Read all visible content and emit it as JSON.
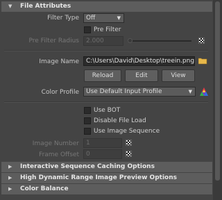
{
  "file_attributes": {
    "title": "File Attributes",
    "filter_type_label": "Filter Type",
    "filter_type_value": "Off",
    "pre_filter_label": "Pre Filter",
    "pre_filter_checked": false,
    "pre_filter_radius_label": "Pre Filter Radius",
    "pre_filter_radius_value": "2.000",
    "image_name_label": "Image Name",
    "image_name_value": "C:\\Users\\David\\Desktop\\treein.png",
    "reload_label": "Reload",
    "edit_label": "Edit",
    "view_label": "View",
    "color_profile_label": "Color Profile",
    "color_profile_value": "Use Default Input Profile",
    "use_bot_label": "Use BOT",
    "disable_file_load_label": "Disable File Load",
    "use_image_sequence_label": "Use Image Sequence",
    "image_number_label": "Image Number",
    "image_number_value": "1",
    "frame_offset_label": "Frame Offset",
    "frame_offset_value": "0"
  },
  "collapsed_sections": [
    "Interactive Sequence Caching Options",
    "High Dynamic Range Image Preview Options",
    "Color Balance"
  ],
  "icons": {
    "section_expanded": "triangle-down-icon",
    "section_collapsed": "triangle-right-icon",
    "folder": "folder-icon",
    "color_wheel": "color-wheel-icon",
    "map": "checker-map-icon"
  },
  "colors": {
    "panel_bg": "#444444",
    "header_bg": "#5d5d5d",
    "field_bg": "#2b2b2b",
    "folder_yellow": "#e8b84a"
  }
}
